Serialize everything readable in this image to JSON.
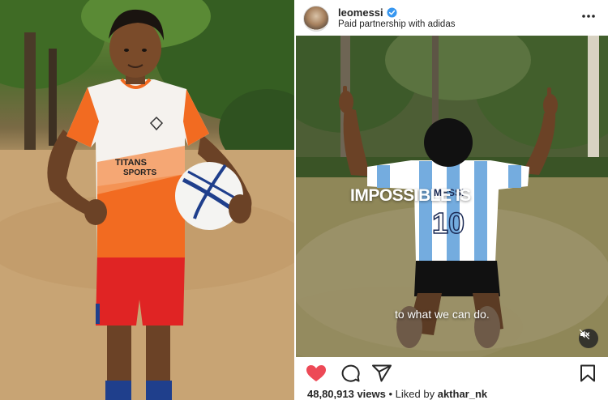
{
  "post": {
    "username": "leomessi",
    "partnership": "Paid partnership with adidas",
    "views": "48,80,913 views",
    "separator": "•",
    "liked_prefix": "Liked by",
    "liked_user": "akthar_nk"
  },
  "video": {
    "caption_big": "IMPOSSIBLE IS",
    "caption_small": "to what we can do."
  },
  "photo": {
    "jersey_brand_line1": "TITANS",
    "jersey_brand_line2": "SPORTS"
  },
  "jersey_back": {
    "name": "MESSI",
    "number": "10"
  },
  "colors": {
    "like_red": "#ed4956",
    "verified_blue": "#3897f0",
    "text": "#262626",
    "jersey_orange": "#f26b21",
    "shorts_red": "#e02424",
    "argentina_blue": "#74acdf"
  },
  "icons": [
    "verified-icon",
    "more-icon",
    "mute-icon",
    "like-icon",
    "comment-icon",
    "share-icon",
    "save-icon"
  ]
}
